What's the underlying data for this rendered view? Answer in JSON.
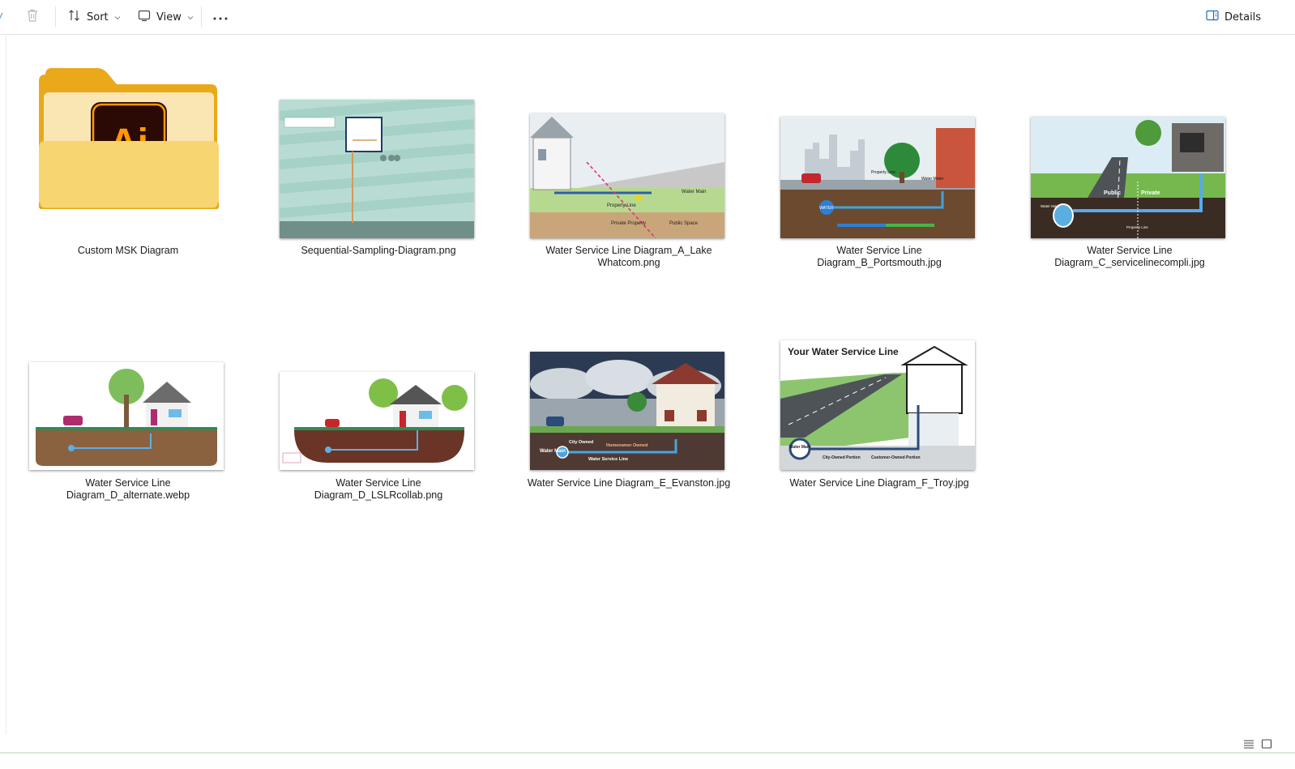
{
  "toolbar": {
    "sort_label": "Sort",
    "view_label": "View",
    "details_label": "Details"
  },
  "items": [
    {
      "name": "Custom MSK Diagram",
      "type": "folder"
    },
    {
      "name": "Sequential-Sampling-Diagram.png",
      "type": "image"
    },
    {
      "name": "Water Service Line Diagram_A_Lake Whatcom.png",
      "type": "image"
    },
    {
      "name": "Water Service Line Diagram_B_Portsmouth.jpg",
      "type": "image"
    },
    {
      "name": "Water Service Line Diagram_C_servicelinecompli.jpg",
      "type": "image"
    },
    {
      "name": "Water Service Line Diagram_D_alternate.webp",
      "type": "image"
    },
    {
      "name": "Water Service Line Diagram_D_LSLRcollab.png",
      "type": "image"
    },
    {
      "name": "Water Service Line Diagram_E_Evanston.jpg",
      "type": "image"
    },
    {
      "name": "Water Service Line Diagram_F_Troy.jpg",
      "type": "image"
    }
  ],
  "thumbnails": {
    "folder_badge": "Ai",
    "troy_title": "Your Water Service Line",
    "lake_whatcom": {
      "property_line": "Property Line",
      "water_main": "Water Main",
      "private_property": "Private Property",
      "public_space": "Public Space"
    },
    "portsmouth": {
      "water": "WATER",
      "water_meter": "Water Meter",
      "property_line": "Property Line"
    },
    "servicelinecompli": {
      "public": "Public",
      "private": "Private",
      "water_main": "Water Main",
      "property_line": "Property Line"
    },
    "evanston": {
      "city_owned": "City Owned",
      "homeowner_owned": "Homeowner Owned",
      "water_main": "Water Main",
      "water_service_line": "Water Service Line"
    },
    "troy": {
      "water_main": "Water Main",
      "city_owned": "City-Owned Portion",
      "customer_owned": "Customer-Owned Portion"
    }
  },
  "colors": {
    "folder_back": "#e9a91b",
    "folder_front": "#f7d570",
    "ai_bg": "#2b0a06",
    "ai_text": "#ff9a00",
    "details_icon": "#1a6fbf"
  },
  "icons": {
    "sort": "sort-icon",
    "view": "view-icon",
    "more": "more-icon",
    "delete": "trash-icon",
    "details": "details-pane-icon"
  }
}
